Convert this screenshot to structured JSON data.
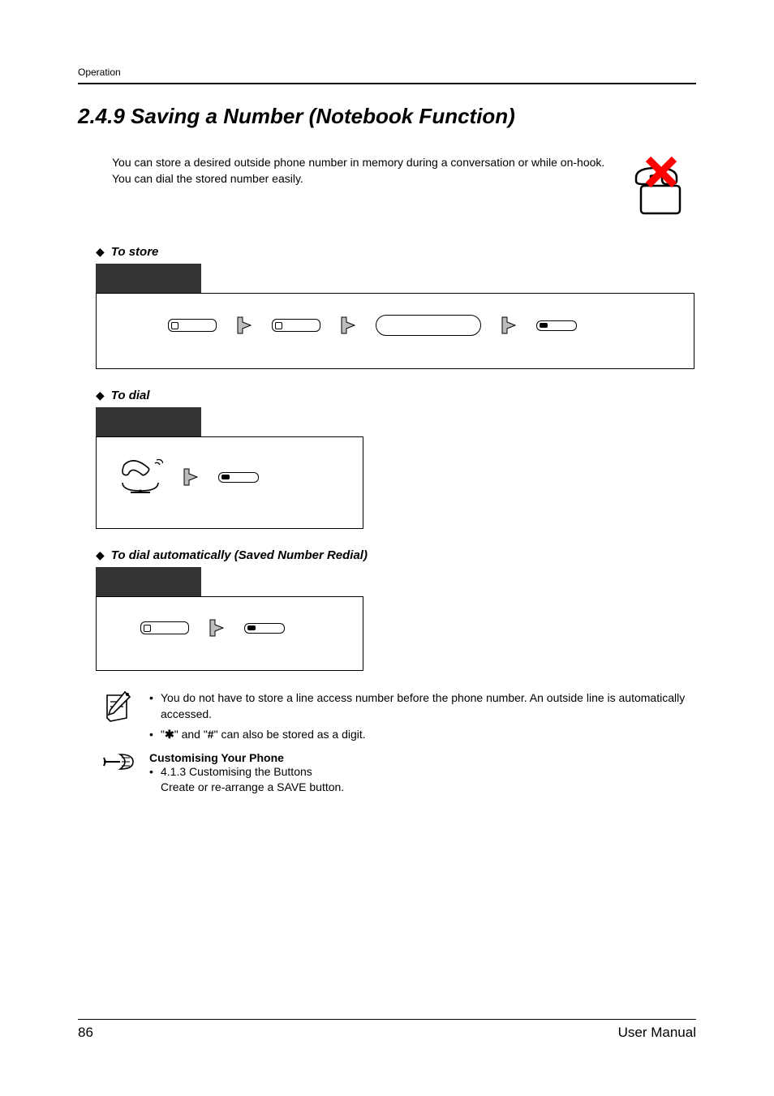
{
  "running_header": "Operation",
  "title": "2.4.9    Saving a Number (Notebook Function)",
  "intro": "You can store a desired outside phone number in memory during a conversation or while on-hook. You can dial the stored number easily.",
  "headings": {
    "store": "To store",
    "dial": "To dial",
    "dial_auto": "To dial automatically (Saved Number Redial)"
  },
  "notes": {
    "n1": "You do not have to store a line access number before the phone number. An outside line is automatically accessed.",
    "n2_prefix": "\"",
    "n2_mid": "\" and \"",
    "n2_suffix": "\" can also be stored as a digit.",
    "star": "✱",
    "hash": "#"
  },
  "customising": {
    "title": "Customising Your Phone",
    "item_ref": "4.1.3   Customising the Buttons",
    "item_desc": "Create or re-arrange a SAVE button."
  },
  "footer": {
    "page": "86",
    "book": "User Manual"
  }
}
